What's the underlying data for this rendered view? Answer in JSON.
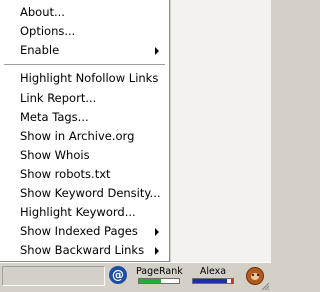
{
  "menu": {
    "items": [
      {
        "label": "About...",
        "submenu": false
      },
      {
        "label": "Options...",
        "submenu": false
      },
      {
        "label": "Enable",
        "submenu": true
      },
      {
        "label": "Highlight Nofollow Links",
        "submenu": false
      },
      {
        "label": "Link Report...",
        "submenu": false
      },
      {
        "label": "Meta Tags...",
        "submenu": false
      },
      {
        "label": "Show in Archive.org",
        "submenu": false
      },
      {
        "label": "Show Whois",
        "submenu": false
      },
      {
        "label": "Show robots.txt",
        "submenu": false
      },
      {
        "label": "Show Keyword Density...",
        "submenu": false
      },
      {
        "label": "Highlight Keyword...",
        "submenu": false
      },
      {
        "label": "Show Indexed Pages",
        "submenu": true
      },
      {
        "label": "Show Backward Links",
        "submenu": true
      }
    ]
  },
  "statusbar": {
    "pagerank_label": "PageRank",
    "pagerank_fraction": 0.55,
    "alexa_label": "Alexa",
    "alexa_fraction": 0.85,
    "icons": [
      "at-sign-icon",
      "monkey-icon"
    ]
  },
  "colors": {
    "pagerank_bar": "#2aa83a",
    "alexa_bar": "#1e2f9e"
  }
}
